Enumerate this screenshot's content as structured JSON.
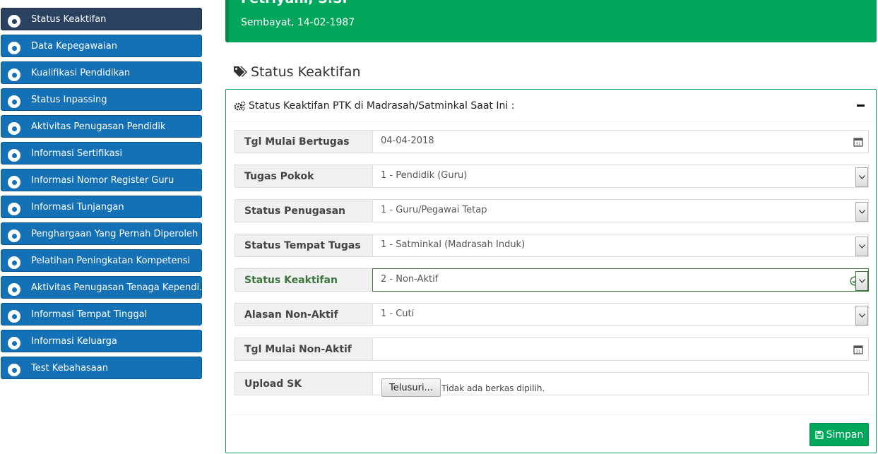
{
  "sidebar": {
    "items": [
      {
        "label": "Status Keaktifan",
        "active": true
      },
      {
        "label": "Data Kepegawaian"
      },
      {
        "label": "Kualifikasi Pendidikan"
      },
      {
        "label": "Status Inpassing"
      },
      {
        "label": "Aktivitas Penugasan Pendidik"
      },
      {
        "label": "Informasi Sertifikasi"
      },
      {
        "label": "Informasi Nomor Register Guru"
      },
      {
        "label": "Informasi Tunjangan"
      },
      {
        "label": "Penghargaan Yang Pernah Diperoleh"
      },
      {
        "label": "Pelatihan Peningkatan Kompetensi"
      },
      {
        "label": "Aktivitas Penugasan Tenaga Kependi..."
      },
      {
        "label": "Informasi Tempat Tinggal"
      },
      {
        "label": "Informasi Keluarga"
      },
      {
        "label": "Test Kebahasaan"
      }
    ]
  },
  "profile": {
    "name": "Fetriyani, S.Si",
    "birth": "Sembayat, 14-02-1987"
  },
  "section": {
    "title": "Status Keaktifan"
  },
  "box": {
    "title": "Status Keaktifan PTK di Madrasah/Satminkal Saat Ini :",
    "fields": [
      {
        "label": "Tgl Mulai Bertugas",
        "value": "04-04-2018",
        "type": "date"
      },
      {
        "label": "Tugas Pokok",
        "value": "1 - Pendidik (Guru)",
        "type": "select"
      },
      {
        "label": "Status Penugasan",
        "value": "1 - Guru/Pegawai Tetap",
        "type": "select"
      },
      {
        "label": "Status Tempat Tugas",
        "value": "1 - Satminkal (Madrasah Induk)",
        "type": "select"
      },
      {
        "label": "Status Keaktifan",
        "value": "2 - Non-Aktif",
        "type": "select-valid"
      },
      {
        "label": "Alasan Non-Aktif",
        "value": "1 - Cuti",
        "type": "select"
      },
      {
        "label": "Tgl Mulai Non-Aktif",
        "value": "",
        "type": "date"
      }
    ],
    "upload": {
      "label": "Upload SK",
      "button": "Telusuri...",
      "status": "Tidak ada berkas dipilih."
    },
    "save_label": "Simpan"
  },
  "colors": {
    "sidebar_item": "#1471b6",
    "sidebar_active": "#2a4160",
    "header_green": "#00a65a",
    "valid_green": "#3c763d"
  },
  "icons": {
    "sidebar": "circle-dot-icon",
    "section": "tags-icon",
    "box": "gears-icon",
    "date": "calendar-icon",
    "save": "floppy-icon"
  }
}
